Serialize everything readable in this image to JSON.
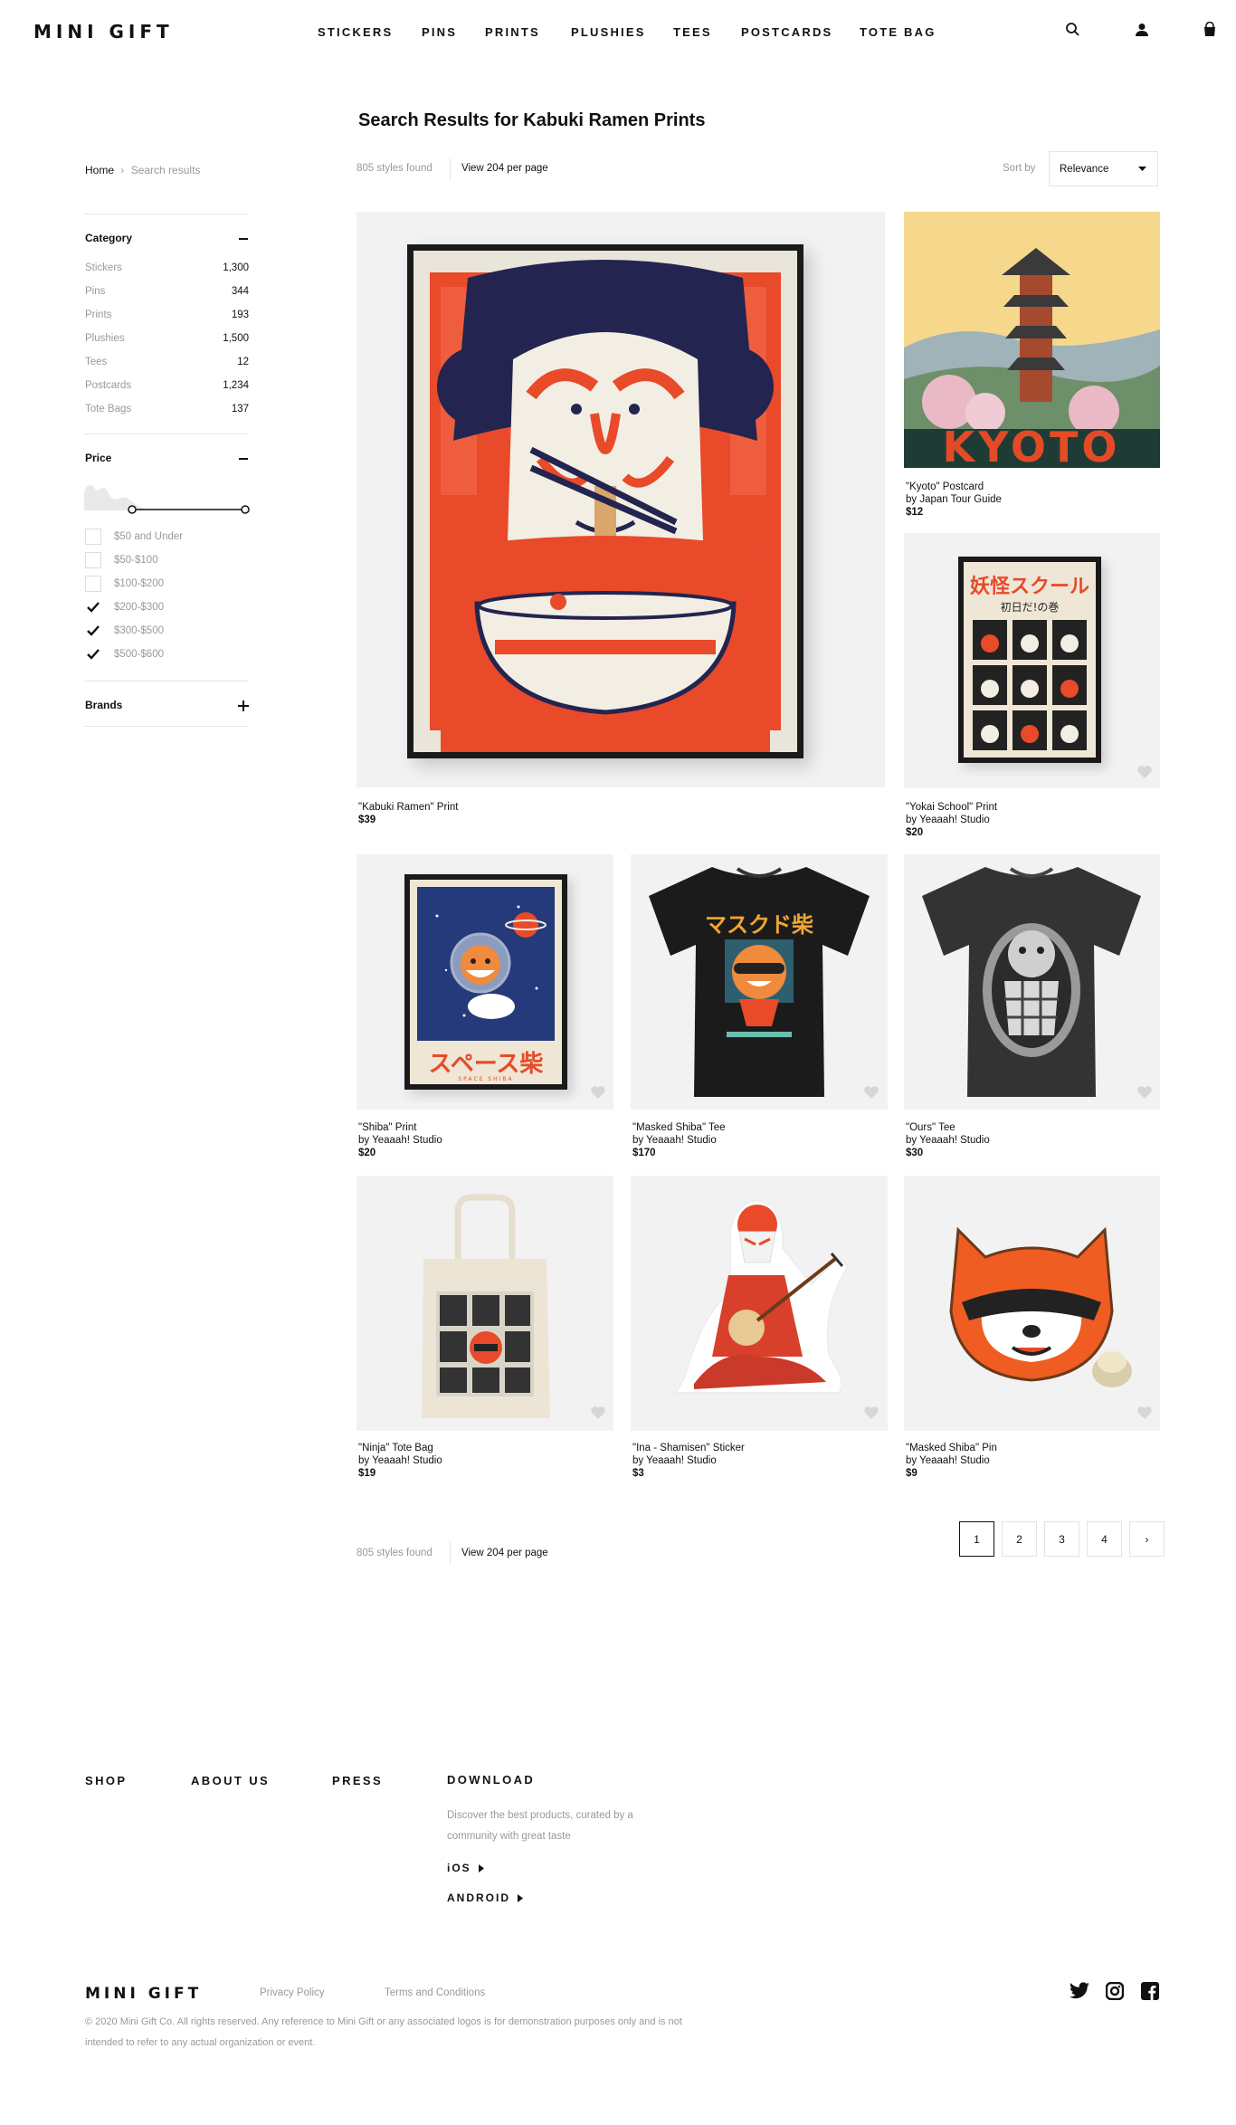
{
  "brand": "MINI GIFT",
  "nav": [
    "STICKERS",
    "PINS",
    "PRINTS",
    "PLUSHIES",
    "TEES",
    "POSTCARDS",
    "TOTE BAG"
  ],
  "header_icons": [
    "search-icon",
    "user-icon",
    "bag-icon"
  ],
  "page_title": "Search Results for Kabuki Ramen Prints",
  "breadcrumb": {
    "home": "Home",
    "sep": "›",
    "current": "Search results"
  },
  "results": {
    "count_label": "805 styles found",
    "per_page_label": "View 204 per page",
    "sort_label": "Sort by",
    "sort_value": "Relevance"
  },
  "filters": {
    "category": {
      "title": "Category",
      "items": [
        {
          "label": "Stickers",
          "count": "1,300"
        },
        {
          "label": "Pins",
          "count": "344"
        },
        {
          "label": "Prints",
          "count": "193"
        },
        {
          "label": "Plushies",
          "count": "1,500"
        },
        {
          "label": "Tees",
          "count": "12"
        },
        {
          "label": "Postcards",
          "count": "1,234"
        },
        {
          "label": "Tote Bags",
          "count": "137"
        }
      ]
    },
    "price": {
      "title": "Price",
      "options": [
        {
          "label": "$50 and Under",
          "checked": false
        },
        {
          "label": "$50-$100",
          "checked": false
        },
        {
          "label": "$100-$200",
          "checked": false
        },
        {
          "label": "$200-$300",
          "checked": true
        },
        {
          "label": "$300-$500",
          "checked": true
        },
        {
          "label": "$500-$600",
          "checked": true
        }
      ]
    },
    "brands": {
      "title": "Brands"
    }
  },
  "products": [
    {
      "title": "\"Kabuki Ramen\" Print",
      "by": "",
      "price": "$39"
    },
    {
      "title": "\"Kyoto\" Postcard",
      "by": "by Japan Tour Guide",
      "price": "$12",
      "image_text": "KYOTO"
    },
    {
      "title": "\"Yokai School\" Print",
      "by": "by Yeaaah! Studio",
      "price": "$20",
      "image_text": "妖怪スクール",
      "image_subtext": "初日だ!の巻"
    },
    {
      "title": "\"Shiba\" Print",
      "by": "by Yeaaah! Studio",
      "price": "$20",
      "image_text": "スペース柴",
      "image_subtext": "SPACE SHIBA"
    },
    {
      "title": "\"Masked Shiba\" Tee",
      "by": "by Yeaaah! Studio",
      "price": "$170",
      "image_text": "マスクド柴"
    },
    {
      "title": "\"Ours\" Tee",
      "by": "by Yeaaah! Studio",
      "price": "$30"
    },
    {
      "title": "\"Ninja\" Tote Bag",
      "by": "by Yeaaah! Studio",
      "price": "$19"
    },
    {
      "title": "\"Ina - Shamisen\" Sticker",
      "by": "by Yeaaah! Studio",
      "price": "$3"
    },
    {
      "title": "\"Masked Shiba\" Pin",
      "by": "by Yeaaah! Studio",
      "price": "$9"
    }
  ],
  "pagination": {
    "pages": [
      "1",
      "2",
      "3",
      "4"
    ],
    "current": "1",
    "next": "›"
  },
  "footer": {
    "links": [
      "SHOP",
      "ABOUT US",
      "PRESS"
    ],
    "download": {
      "title": "DOWNLOAD",
      "text": "Discover the best products, curated by a community with great taste",
      "ios": "iOS",
      "android": "ANDROID"
    },
    "brand": "MINI GIFT",
    "legal": [
      "Privacy Policy",
      "Terms and Conditions"
    ],
    "social": [
      "twitter-icon",
      "instagram-icon",
      "facebook-icon"
    ],
    "copyright": "© 2020 Mini Gift Co. All rights reserved. Any reference to Mini Gift or any associated logos is for demonstration purposes only and is not intended to refer to any actual organization or event."
  },
  "colors": {
    "accent": "#e8492a",
    "navy": "#2a2a5c",
    "text": "#111111",
    "muted": "#999999",
    "card_bg": "#f2f2f2"
  }
}
